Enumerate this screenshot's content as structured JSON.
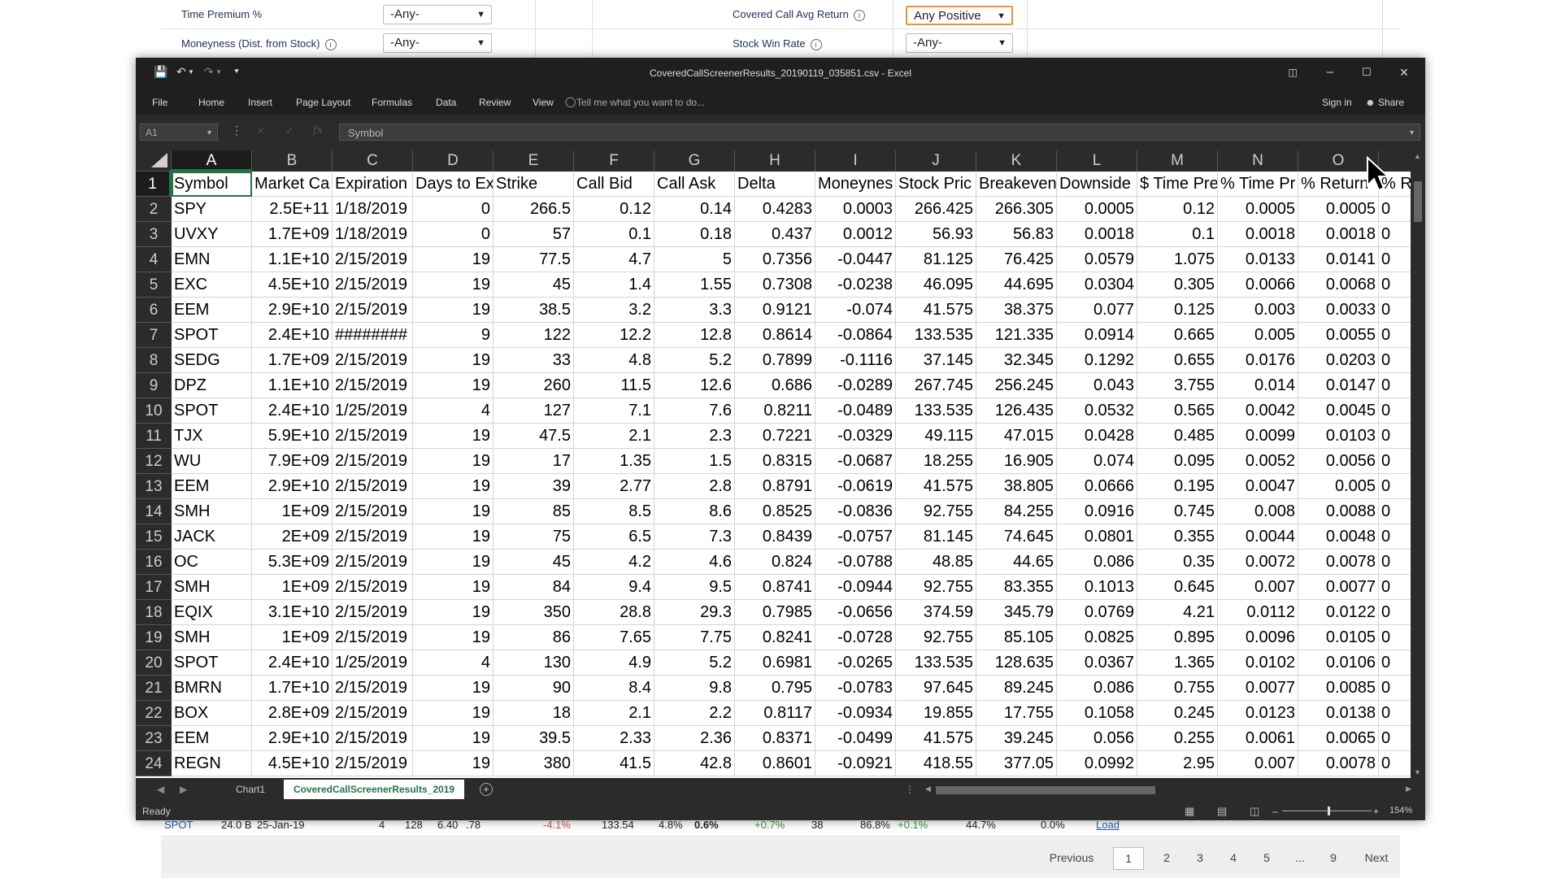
{
  "web": {
    "filters": {
      "row1_label": "Time Premium %",
      "row1_value": "-Any-",
      "row2_label": "Moneyness (Dist. from Stock)",
      "row2_value": "-Any-",
      "right1_label": "Covered Call Avg Return",
      "right1_value": "Any Positive",
      "right2_label": "Stock Win Rate",
      "right2_value": "-Any-",
      "info_icon": "i"
    },
    "bottom_row": [
      "SPOT",
      "24.0 B",
      "25-Jan-19",
      "4",
      "128",
      "6.40",
      ".78",
      "-4.1%",
      "133.54",
      "4.8%",
      "0.6%",
      "+0.7%",
      "38",
      "86.8%",
      "+0.1%",
      "44.7%",
      "0.0%",
      "Load"
    ],
    "pagination": {
      "previous": "Previous",
      "pages": [
        "1",
        "2",
        "3",
        "4",
        "5",
        "...",
        "9"
      ],
      "next": "Next"
    }
  },
  "excel": {
    "window_title": "CoveredCallScreenerResults_20190119_035851.csv - Excel",
    "ribbon_tabs": [
      "File",
      "Home",
      "Insert",
      "Page Layout",
      "Formulas",
      "Data",
      "Review",
      "View"
    ],
    "tell_me": "Tell me what you want to do...",
    "sign_in": "Sign in",
    "share": "Share",
    "name_box": "A1",
    "formula_value": "Symbol",
    "columns": [
      "A",
      "B",
      "C",
      "D",
      "E",
      "F",
      "G",
      "H",
      "I",
      "J",
      "K",
      "L",
      "M",
      "N",
      "O"
    ],
    "header_row": [
      "Symbol",
      "Market Ca",
      "Expiration",
      "Days to Ex",
      "Strike",
      "Call Bid",
      "Call Ask",
      "Delta",
      "Moneynes",
      "Stock Pric",
      "Breakeven",
      "Downside",
      "$ Time Pre",
      "% Time Pr",
      "% Return",
      "% R"
    ],
    "rows": [
      [
        "SPY",
        "2.5E+11",
        "1/18/2019",
        "0",
        "266.5",
        "0.12",
        "0.14",
        "0.4283",
        "0.0003",
        "266.425",
        "266.305",
        "0.0005",
        "0.12",
        "0.0005",
        "0.0005",
        "0"
      ],
      [
        "UVXY",
        "1.7E+09",
        "1/18/2019",
        "0",
        "57",
        "0.1",
        "0.18",
        "0.437",
        "0.0012",
        "56.93",
        "56.83",
        "0.0018",
        "0.1",
        "0.0018",
        "0.0018",
        "0"
      ],
      [
        "EMN",
        "1.1E+10",
        "2/15/2019",
        "19",
        "77.5",
        "4.7",
        "5",
        "0.7356",
        "-0.0447",
        "81.125",
        "76.425",
        "0.0579",
        "1.075",
        "0.0133",
        "0.0141",
        "0"
      ],
      [
        "EXC",
        "4.5E+10",
        "2/15/2019",
        "19",
        "45",
        "1.4",
        "1.55",
        "0.7308",
        "-0.0238",
        "46.095",
        "44.695",
        "0.0304",
        "0.305",
        "0.0066",
        "0.0068",
        "0"
      ],
      [
        "EEM",
        "2.9E+10",
        "2/15/2019",
        "19",
        "38.5",
        "3.2",
        "3.3",
        "0.9121",
        "-0.074",
        "41.575",
        "38.375",
        "0.077",
        "0.125",
        "0.003",
        "0.0033",
        "0"
      ],
      [
        "SPOT",
        "2.4E+10",
        "########",
        "9",
        "122",
        "12.2",
        "12.8",
        "0.8614",
        "-0.0864",
        "133.535",
        "121.335",
        "0.0914",
        "0.665",
        "0.005",
        "0.0055",
        "0"
      ],
      [
        "SEDG",
        "1.7E+09",
        "2/15/2019",
        "19",
        "33",
        "4.8",
        "5.2",
        "0.7899",
        "-0.1116",
        "37.145",
        "32.345",
        "0.1292",
        "0.655",
        "0.0176",
        "0.0203",
        "0"
      ],
      [
        "DPZ",
        "1.1E+10",
        "2/15/2019",
        "19",
        "260",
        "11.5",
        "12.6",
        "0.686",
        "-0.0289",
        "267.745",
        "256.245",
        "0.043",
        "3.755",
        "0.014",
        "0.0147",
        "0"
      ],
      [
        "SPOT",
        "2.4E+10",
        "1/25/2019",
        "4",
        "127",
        "7.1",
        "7.6",
        "0.8211",
        "-0.0489",
        "133.535",
        "126.435",
        "0.0532",
        "0.565",
        "0.0042",
        "0.0045",
        "0"
      ],
      [
        "TJX",
        "5.9E+10",
        "2/15/2019",
        "19",
        "47.5",
        "2.1",
        "2.3",
        "0.7221",
        "-0.0329",
        "49.115",
        "47.015",
        "0.0428",
        "0.485",
        "0.0099",
        "0.0103",
        "0"
      ],
      [
        "WU",
        "7.9E+09",
        "2/15/2019",
        "19",
        "17",
        "1.35",
        "1.5",
        "0.8315",
        "-0.0687",
        "18.255",
        "16.905",
        "0.074",
        "0.095",
        "0.0052",
        "0.0056",
        "0"
      ],
      [
        "EEM",
        "2.9E+10",
        "2/15/2019",
        "19",
        "39",
        "2.77",
        "2.8",
        "0.8791",
        "-0.0619",
        "41.575",
        "38.805",
        "0.0666",
        "0.195",
        "0.0047",
        "0.005",
        "0"
      ],
      [
        "SMH",
        "1E+09",
        "2/15/2019",
        "19",
        "85",
        "8.5",
        "8.6",
        "0.8525",
        "-0.0836",
        "92.755",
        "84.255",
        "0.0916",
        "0.745",
        "0.008",
        "0.0088",
        "0"
      ],
      [
        "JACK",
        "2E+09",
        "2/15/2019",
        "19",
        "75",
        "6.5",
        "7.3",
        "0.8439",
        "-0.0757",
        "81.145",
        "74.645",
        "0.0801",
        "0.355",
        "0.0044",
        "0.0048",
        "0"
      ],
      [
        "OC",
        "5.3E+09",
        "2/15/2019",
        "19",
        "45",
        "4.2",
        "4.6",
        "0.824",
        "-0.0788",
        "48.85",
        "44.65",
        "0.086",
        "0.35",
        "0.0072",
        "0.0078",
        "0"
      ],
      [
        "SMH",
        "1E+09",
        "2/15/2019",
        "19",
        "84",
        "9.4",
        "9.5",
        "0.8741",
        "-0.0944",
        "92.755",
        "83.355",
        "0.1013",
        "0.645",
        "0.007",
        "0.0077",
        "0"
      ],
      [
        "EQIX",
        "3.1E+10",
        "2/15/2019",
        "19",
        "350",
        "28.8",
        "29.3",
        "0.7985",
        "-0.0656",
        "374.59",
        "345.79",
        "0.0769",
        "4.21",
        "0.0112",
        "0.0122",
        "0"
      ],
      [
        "SMH",
        "1E+09",
        "2/15/2019",
        "19",
        "86",
        "7.65",
        "7.75",
        "0.8241",
        "-0.0728",
        "92.755",
        "85.105",
        "0.0825",
        "0.895",
        "0.0096",
        "0.0105",
        "0"
      ],
      [
        "SPOT",
        "2.4E+10",
        "1/25/2019",
        "4",
        "130",
        "4.9",
        "5.2",
        "0.6981",
        "-0.0265",
        "133.535",
        "128.635",
        "0.0367",
        "1.365",
        "0.0102",
        "0.0106",
        "0"
      ],
      [
        "BMRN",
        "1.7E+10",
        "2/15/2019",
        "19",
        "90",
        "8.4",
        "9.8",
        "0.795",
        "-0.0783",
        "97.645",
        "89.245",
        "0.086",
        "0.755",
        "0.0077",
        "0.0085",
        "0"
      ],
      [
        "BOX",
        "2.8E+09",
        "2/15/2019",
        "19",
        "18",
        "2.1",
        "2.2",
        "0.8117",
        "-0.0934",
        "19.855",
        "17.755",
        "0.1058",
        "0.245",
        "0.0123",
        "0.0138",
        "0"
      ],
      [
        "EEM",
        "2.9E+10",
        "2/15/2019",
        "19",
        "39.5",
        "2.33",
        "2.36",
        "0.8371",
        "-0.0499",
        "41.575",
        "39.245",
        "0.056",
        "0.255",
        "0.0061",
        "0.0065",
        "0"
      ],
      [
        "REGN",
        "4.5E+10",
        "2/15/2019",
        "19",
        "380",
        "41.5",
        "42.8",
        "0.8601",
        "-0.0921",
        "418.55",
        "377.05",
        "0.0992",
        "2.95",
        "0.007",
        "0.0078",
        "0"
      ]
    ],
    "sheet_tabs": [
      "Chart1",
      "CoveredCallScreenerResults_2019"
    ],
    "status": "Ready",
    "zoom": "154%"
  }
}
